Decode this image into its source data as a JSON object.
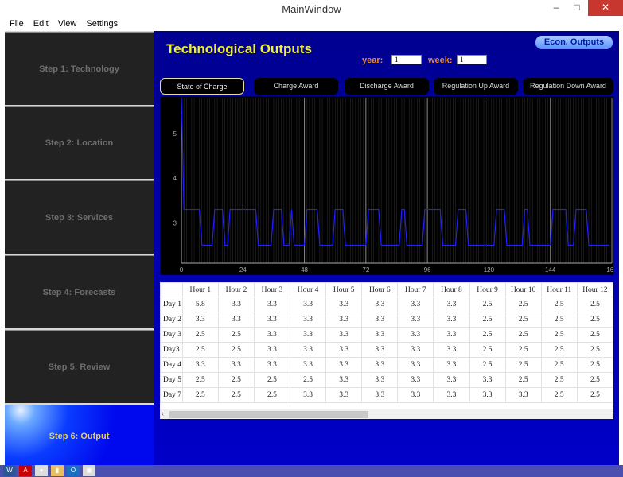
{
  "window": {
    "title": "MainWindow",
    "minimize": "–",
    "maximize": "□",
    "close": "✕"
  },
  "menu": [
    "File",
    "Edit",
    "View",
    "Settings"
  ],
  "sidebar": {
    "steps": [
      {
        "label": "Step 1: Technology",
        "active": false
      },
      {
        "label": "Step 2: Location",
        "active": false
      },
      {
        "label": "Step 3: Services",
        "active": false
      },
      {
        "label": "Step 4: Forecasts",
        "active": false
      },
      {
        "label": "Step 5: Review",
        "active": false
      },
      {
        "label": "Step 6: Output",
        "active": true
      }
    ]
  },
  "main": {
    "title": "Technological Outputs",
    "econ_button": "Econ. Outputs",
    "year_label": "year:",
    "year_value": "1",
    "week_label": "week:",
    "week_value": "1",
    "tabs": [
      {
        "label": "State of Charge",
        "selected": true
      },
      {
        "label": "Charge Award"
      },
      {
        "label": "Discharge Award"
      },
      {
        "label": "Regulation Up Award"
      },
      {
        "label": "Regulation Down Award"
      }
    ]
  },
  "chart_data": {
    "type": "line",
    "xlim": [
      0,
      168
    ],
    "ylim": [
      2.1,
      5.8
    ],
    "xticks": [
      0,
      24,
      48,
      72,
      96,
      120,
      144,
      168
    ],
    "yticks": [
      3,
      4,
      5
    ],
    "grid": true,
    "line_color": "#2020ff",
    "values": [
      5.8,
      3.3,
      3.3,
      3.3,
      3.3,
      3.3,
      3.3,
      3.3,
      2.5,
      2.5,
      2.5,
      2.5,
      2.5,
      3.3,
      3.3,
      3.3,
      3.3,
      2.5,
      2.5,
      3.3,
      3.3,
      3.3,
      3.3,
      3.3,
      3.3,
      3.3,
      3.3,
      3.3,
      3.3,
      3.3,
      2.5,
      2.5,
      2.5,
      2.5,
      2.5,
      2.5,
      3.3,
      3.3,
      3.3,
      3.3,
      2.5,
      2.5,
      2.5,
      3.3,
      2.5,
      2.5,
      2.5,
      2.5,
      2.5,
      3.3,
      3.3,
      3.3,
      3.3,
      3.3,
      2.5,
      2.5,
      2.5,
      2.5,
      2.5,
      2.5,
      3.3,
      3.3,
      3.3,
      3.3,
      2.5,
      2.5,
      2.5,
      2.5,
      2.5,
      2.5,
      2.5,
      2.5,
      2.5,
      3.3,
      3.3,
      3.3,
      3.3,
      3.3,
      2.5,
      2.5,
      2.5,
      2.5,
      2.5,
      2.5,
      2.5,
      2.5,
      3.3,
      3.3,
      2.5,
      2.5,
      2.5,
      2.5,
      2.5,
      2.5,
      2.5,
      3.3,
      3.3,
      3.3,
      3.3,
      3.3,
      3.3,
      3.3,
      2.5,
      2.5,
      2.5,
      2.5,
      2.5,
      2.5,
      3.3,
      3.3,
      3.3,
      3.3,
      2.5,
      2.5,
      2.5,
      2.5,
      2.5,
      2.5,
      2.5,
      2.5,
      2.5,
      2.5,
      2.5,
      3.3,
      3.3,
      3.3,
      3.3,
      2.5,
      2.5,
      2.5,
      2.5,
      2.5,
      2.5,
      2.5,
      3.3,
      3.3,
      2.5,
      2.5,
      2.5,
      2.5,
      2.5,
      2.5,
      2.5,
      2.5,
      2.5,
      3.3,
      3.3,
      3.3,
      3.3,
      3.3,
      3.3,
      2.5,
      2.5,
      2.5,
      3.3,
      3.3,
      3.3,
      3.3,
      3.3,
      2.5,
      2.5,
      2.5,
      2.5,
      2.5,
      2.5,
      2.5,
      2.5,
      2.5
    ]
  },
  "table": {
    "columns": [
      "Hour 1",
      "Hour 2",
      "Hour 3",
      "Hour 4",
      "Hour 5",
      "Hour 6",
      "Hour 7",
      "Hour 8",
      "Hour 9",
      "Hour 10",
      "Hour 11",
      "Hour 12"
    ],
    "rows": [
      {
        "label": "Day 1",
        "values": [
          "5.8",
          "3.3",
          "3.3",
          "3.3",
          "3.3",
          "3.3",
          "3.3",
          "3.3",
          "2.5",
          "2.5",
          "2.5",
          "2.5"
        ]
      },
      {
        "label": "Day 2",
        "values": [
          "3.3",
          "3.3",
          "3.3",
          "3.3",
          "3.3",
          "3.3",
          "3.3",
          "3.3",
          "2.5",
          "2.5",
          "2.5",
          "2.5"
        ]
      },
      {
        "label": "Day 3",
        "values": [
          "2.5",
          "2.5",
          "3.3",
          "3.3",
          "3.3",
          "3.3",
          "3.3",
          "3.3",
          "2.5",
          "2.5",
          "2.5",
          "2.5"
        ]
      },
      {
        "label": "Day3",
        "values": [
          "2.5",
          "2.5",
          "3.3",
          "3.3",
          "3.3",
          "3.3",
          "3.3",
          "3.3",
          "2.5",
          "2.5",
          "2.5",
          "2.5"
        ]
      },
      {
        "label": "Day 4",
        "values": [
          "3.3",
          "3.3",
          "3.3",
          "3.3",
          "3.3",
          "3.3",
          "3.3",
          "3.3",
          "2.5",
          "2.5",
          "2.5",
          "2.5"
        ]
      },
      {
        "label": "Day 5",
        "values": [
          "2.5",
          "2.5",
          "2.5",
          "2.5",
          "3.3",
          "3.3",
          "3.3",
          "3.3",
          "3.3",
          "2.5",
          "2.5",
          "2.5"
        ]
      },
      {
        "label": "Day 7",
        "values": [
          "2.5",
          "2.5",
          "2.5",
          "3.3",
          "3.3",
          "3.3",
          "3.3",
          "3.3",
          "3.3",
          "3.3",
          "2.5",
          "2.5"
        ]
      }
    ]
  },
  "taskbar": [
    {
      "icon": "word-icon",
      "label": "W"
    },
    {
      "icon": "acrobat-icon",
      "label": "A"
    },
    {
      "icon": "chrome-icon",
      "label": "●"
    },
    {
      "icon": "folder-icon",
      "label": "▮"
    },
    {
      "icon": "outlook-icon",
      "label": "O"
    },
    {
      "icon": "app-icon",
      "label": "▣"
    }
  ]
}
